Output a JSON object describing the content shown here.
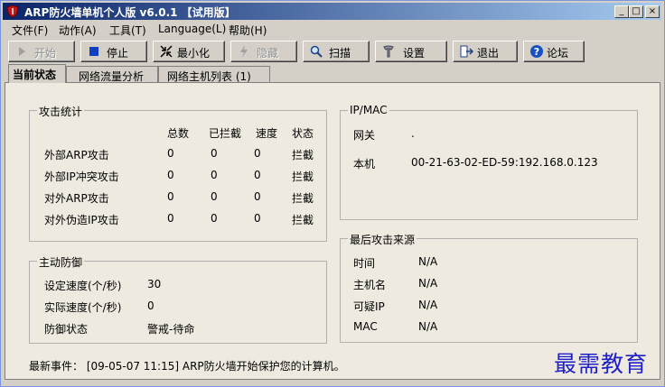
{
  "window": {
    "title": "ARP防火墙单机个人版 v6.0.1 【试用版】",
    "controls": {
      "minimize": "_",
      "maximize": "□",
      "close": "×"
    }
  },
  "menu": [
    "文件(F)",
    "动作(A)",
    "工具(T)",
    "Language(L)",
    "帮助(H)"
  ],
  "toolbar": {
    "start": "开始",
    "stop": "停止",
    "minimize": "最小化",
    "hide": "隐藏",
    "scan": "扫描",
    "settings": "设置",
    "exit": "退出",
    "forum": "论坛"
  },
  "tabs": [
    "当前状态",
    "网络流量分析",
    "网络主机列表 (1)"
  ],
  "attack_stats": {
    "title": "攻击统计",
    "headers": [
      "总数",
      "已拦截",
      "速度",
      "状态"
    ],
    "rows": [
      {
        "name": "外部ARP攻击",
        "total": "0",
        "blocked": "0",
        "speed": "0",
        "status": "拦截"
      },
      {
        "name": "外部IP冲突攻击",
        "total": "0",
        "blocked": "0",
        "speed": "0",
        "status": "拦截"
      },
      {
        "name": "对外ARP攻击",
        "total": "0",
        "blocked": "0",
        "speed": "0",
        "status": "拦截"
      },
      {
        "name": "对外伪造IP攻击",
        "total": "0",
        "blocked": "0",
        "speed": "0",
        "status": "拦截"
      }
    ]
  },
  "active_defense": {
    "title": "主动防御",
    "set_speed_label": "设定速度(个/秒)",
    "set_speed_value": "30",
    "actual_speed_label": "实际速度(个/秒)",
    "actual_speed_value": "0",
    "state_label": "防御状态",
    "state_value": "警戒-待命"
  },
  "ipmac": {
    "title": "IP/MAC",
    "gateway_label": "网关",
    "gateway_value": ".",
    "local_label": "本机",
    "local_value": "00-21-63-02-ED-59:192.168.0.123"
  },
  "last_attack": {
    "title": "最后攻击来源",
    "rows": [
      {
        "label": "时间",
        "value": "N/A"
      },
      {
        "label": "主机名",
        "value": "N/A"
      },
      {
        "label": "可疑IP",
        "value": "N/A"
      },
      {
        "label": "MAC",
        "value": "N/A"
      }
    ]
  },
  "status_event": "最新事件： [09-05-07 11:15] ARP防火墙开始保护您的计算机。",
  "watermark": "最需教育"
}
